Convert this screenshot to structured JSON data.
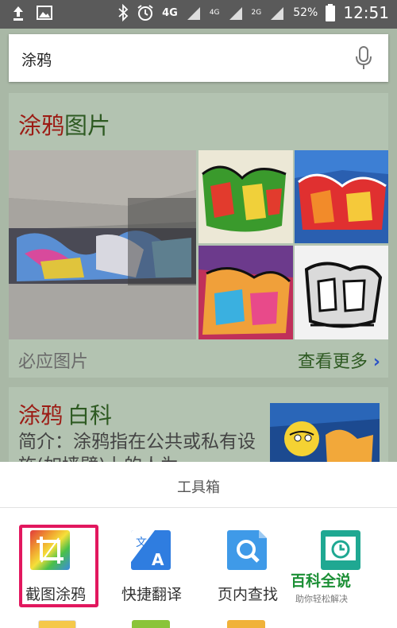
{
  "status_bar": {
    "network_4g_a": "4G",
    "network_4g_b": "4G",
    "network_2g": "2G",
    "battery": "52%",
    "time": "12:51"
  },
  "search": {
    "query": "涂鸦"
  },
  "images_card": {
    "title_red": "涂鸦",
    "title_green": "图片",
    "source_label": "必应图片",
    "more_label": "查看更多",
    "chevron": "›"
  },
  "encyclopedia_card": {
    "title_red": "涂鸦",
    "title_green": "白科",
    "desc": "简介：涂鸦指在公共或私有设施(如墙壁)上的人为"
  },
  "toolbox": {
    "title": "工具箱",
    "items": [
      {
        "label": "截图涂鸦",
        "icon": "screenshot-doodle-icon"
      },
      {
        "label": "快捷翻译",
        "icon": "translate-icon"
      },
      {
        "label": "页内查找",
        "icon": "find-in-page-icon"
      },
      {
        "label": "",
        "icon": "history-clock-icon"
      }
    ]
  },
  "watermark": {
    "brand": "百科全说",
    "tagline": "助你轻松解决"
  },
  "colors": {
    "highlight": "#e2175e",
    "title_red": "#9c1b14",
    "title_green": "#2e5a22"
  }
}
